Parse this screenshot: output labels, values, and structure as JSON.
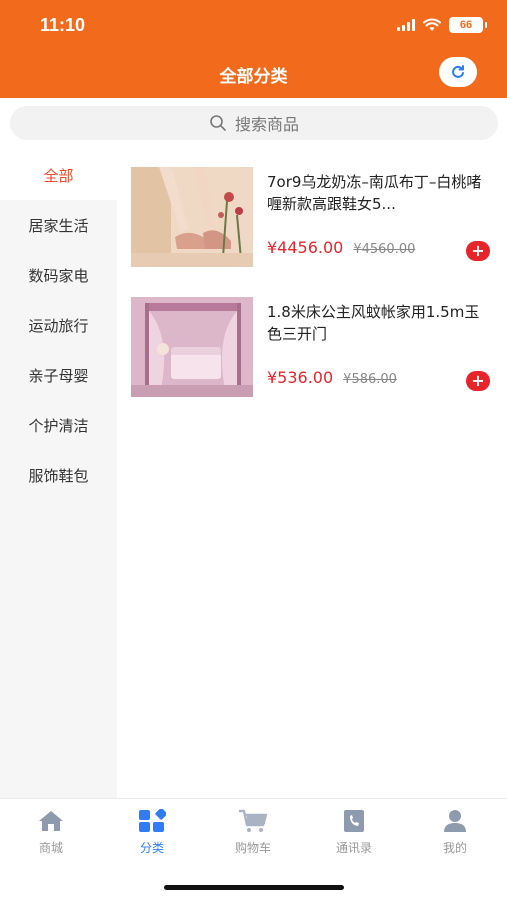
{
  "status_bar": {
    "time": "11:10",
    "battery": "66"
  },
  "header": {
    "title": "全部分类"
  },
  "search": {
    "placeholder": "搜索商品"
  },
  "sidebar": {
    "items": [
      {
        "label": "全部",
        "active": true
      },
      {
        "label": "居家生活",
        "active": false
      },
      {
        "label": "数码家电",
        "active": false
      },
      {
        "label": "运动旅行",
        "active": false
      },
      {
        "label": "亲子母婴",
        "active": false
      },
      {
        "label": "个护清洁",
        "active": false
      },
      {
        "label": "服饰鞋包",
        "active": false
      }
    ]
  },
  "products": [
    {
      "name": "7or9乌龙奶冻–南瓜布丁–白桃啫喱新款高跟鞋女5...",
      "price": "¥4456.00",
      "old_price": "¥4560.00",
      "add_icon": "plus-icon"
    },
    {
      "name": "1.8米床公主风蚊帐家用1.5m玉色三开门",
      "price": "¥536.00",
      "old_price": "¥586.00",
      "add_icon": "plus-icon"
    }
  ],
  "tabbar": {
    "items": [
      {
        "label": "商城",
        "icon": "home-icon",
        "active": false
      },
      {
        "label": "分类",
        "icon": "category-icon",
        "active": true
      },
      {
        "label": "购物车",
        "icon": "cart-icon",
        "active": false
      },
      {
        "label": "通讯录",
        "icon": "contacts-icon",
        "active": false
      },
      {
        "label": "我的",
        "icon": "profile-icon",
        "active": false
      }
    ]
  },
  "colors": {
    "accent": "#f26b1d",
    "price": "#e8242b",
    "active_tab": "#2f7cf6",
    "sidebar_active": "#f04a2b"
  }
}
